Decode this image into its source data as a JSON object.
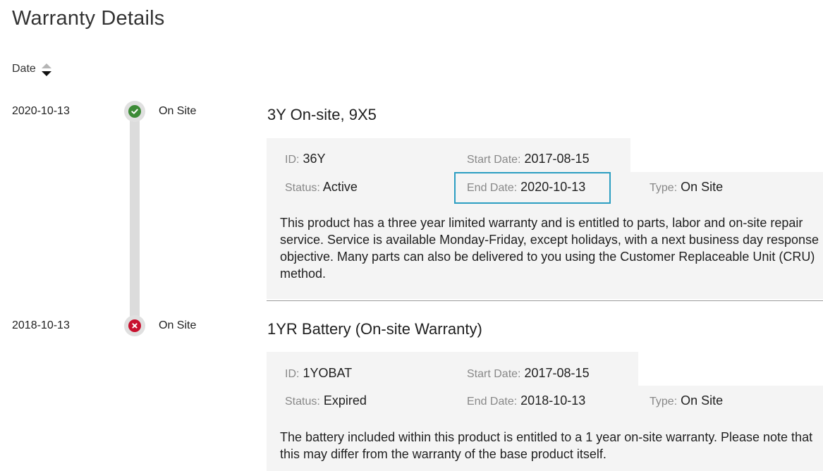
{
  "page": {
    "title": "Warranty Details"
  },
  "sort": {
    "label": "Date"
  },
  "warranties": [
    {
      "date": "2020-10-13",
      "state": "active",
      "type_short": "On Site",
      "title": "3Y On-site, 9X5",
      "id_label": "ID:",
      "id_value": "36Y",
      "start_label": "Start Date:",
      "start_value": "2017-08-15",
      "status_label": "Status:",
      "status_value": "Active",
      "end_label": "End Date:",
      "end_value": "2020-10-13",
      "type_label": "Type:",
      "type_value": "On Site",
      "description": "This product has a three year limited warranty and is entitled to parts, labor and on-site repair service. Service is available Monday-Friday, except holidays, with a next business day response objective. Many parts can also be delivered to you using the Customer Replaceable Unit (CRU) method."
    },
    {
      "date": "2018-10-13",
      "state": "expired",
      "type_short": "On Site",
      "title": "1YR Battery (On-site Warranty)",
      "id_label": "ID:",
      "id_value": "1YOBAT",
      "start_label": "Start Date:",
      "start_value": "2017-08-15",
      "status_label": "Status:",
      "status_value": "Expired",
      "end_label": "End Date:",
      "end_value": "2018-10-13",
      "type_label": "Type:",
      "type_value": "On Site",
      "description": "The battery included within this product is entitled to a 1 year on-site warranty. Please note that this may differ from the warranty of the base product itself."
    }
  ],
  "colors": {
    "active_green": "#3d8b37",
    "expired_red": "#c8102e",
    "highlight_border": "#2b9ec2",
    "panel_bg": "#f4f4f4"
  }
}
